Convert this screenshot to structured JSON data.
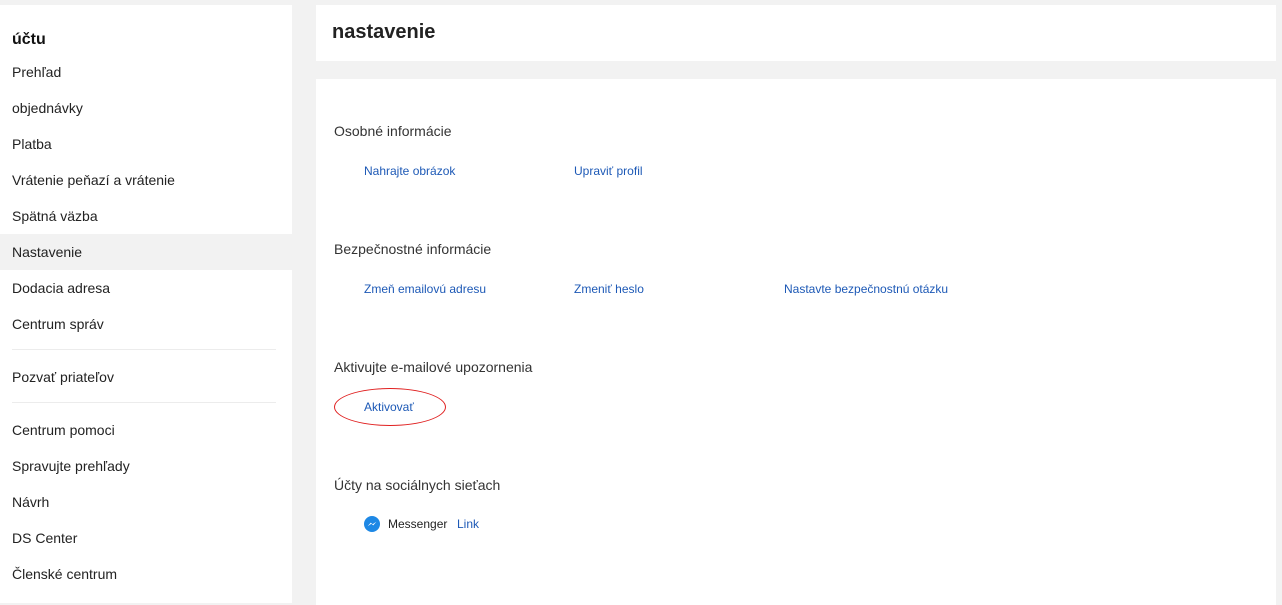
{
  "sidebar": {
    "title": "účtu",
    "items": [
      {
        "label": "Prehľad"
      },
      {
        "label": "objednávky"
      },
      {
        "label": "Platba"
      },
      {
        "label": "Vrátenie peňazí a vrátenie"
      },
      {
        "label": "Spätná väzba"
      },
      {
        "label": "Nastavenie"
      },
      {
        "label": "Dodacia adresa"
      },
      {
        "label": "Centrum správ"
      },
      {
        "label": "Pozvať priateľov"
      },
      {
        "label": "Centrum pomoci"
      },
      {
        "label": "Spravujte prehľady"
      },
      {
        "label": "Návrh"
      },
      {
        "label": "DS Center"
      },
      {
        "label": "Členské centrum"
      }
    ],
    "active_item": "Nastavenie"
  },
  "header": {
    "title": "nastavenie"
  },
  "sections": {
    "personal": {
      "title": "Osobné informácie",
      "links": [
        "Nahrajte obrázok",
        "Upraviť profil"
      ]
    },
    "security": {
      "title": "Bezpečnostné informácie",
      "links": [
        "Zmeň emailovú adresu",
        "Zmeniť heslo",
        "Nastavte bezpečnostnú otázku"
      ]
    },
    "email_notifications": {
      "title": "Aktivujte e-mailové upozornenia",
      "link": "Aktivovať"
    },
    "social": {
      "title": "Účty na sociálnych sieťach",
      "accounts": [
        {
          "name": "Messenger",
          "icon": "messenger-icon",
          "action": "Link"
        }
      ]
    }
  },
  "colors": {
    "link": "#1d59b6",
    "highlight": "#e02020",
    "messenger": "#1e88e5",
    "active_bg": "#f2f2f2"
  }
}
